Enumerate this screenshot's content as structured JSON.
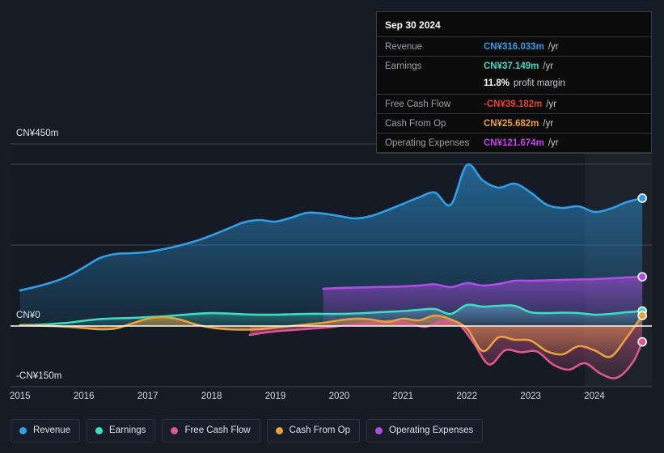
{
  "tooltip": {
    "title": "Sep 30 2024",
    "rows": [
      {
        "key": "Revenue",
        "value": "CN¥316.033m",
        "suffix": "/yr",
        "color": "#2f9fe8"
      },
      {
        "key": "Earnings",
        "value": "CN¥37.149m",
        "suffix": "/yr",
        "color": "#3ddcc4"
      },
      {
        "key": "",
        "value": "11.8%",
        "suffix": "profit margin",
        "color": "#ffffff",
        "sub": true
      },
      {
        "key": "Free Cash Flow",
        "value": "-CN¥39.182m",
        "suffix": "/yr",
        "color": "#e8442f"
      },
      {
        "key": "Cash From Op",
        "value": "CN¥25.682m",
        "suffix": "/yr",
        "color": "#e9a13b"
      },
      {
        "key": "Operating Expenses",
        "value": "CN¥121.674m",
        "suffix": "/yr",
        "color": "#cc3ef0"
      }
    ]
  },
  "axes": {
    "y_top_label": "CN¥450m",
    "y_zero_label": "CN¥0",
    "y_bottom_label": "-CN¥150m",
    "x_labels": [
      "2015",
      "2016",
      "2017",
      "2018",
      "2019",
      "2020",
      "2021",
      "2022",
      "2023",
      "2024"
    ]
  },
  "legend": {
    "items": [
      {
        "label": "Revenue",
        "color": "#2f9fe8"
      },
      {
        "label": "Earnings",
        "color": "#3ddcc4"
      },
      {
        "label": "Free Cash Flow",
        "color": "#e0578f"
      },
      {
        "label": "Cash From Op",
        "color": "#e9a13b"
      },
      {
        "label": "Operating Expenses",
        "color": "#b24ce8"
      }
    ]
  },
  "chart_data": {
    "type": "area",
    "title": "",
    "xlabel": "",
    "ylabel": "CN¥ (millions)",
    "ylim": [
      -150,
      450
    ],
    "xlim": [
      2014.85,
      2024.9
    ],
    "grid": true,
    "legend_position": "bottom",
    "currency": "CN¥",
    "unit": "m",
    "y_ticks": [
      450,
      400,
      200,
      0,
      -150
    ],
    "forecast_start": 2023.85,
    "series": [
      {
        "name": "Revenue",
        "color": "#2f9fe8",
        "x": [
          2015.0,
          2015.25,
          2015.5,
          2015.75,
          2016.0,
          2016.25,
          2016.5,
          2016.75,
          2017.0,
          2017.25,
          2017.5,
          2017.75,
          2018.0,
          2018.25,
          2018.5,
          2018.75,
          2019.0,
          2019.25,
          2019.5,
          2019.75,
          2020.0,
          2020.25,
          2020.5,
          2020.75,
          2021.0,
          2021.25,
          2021.5,
          2021.75,
          2022.0,
          2022.25,
          2022.5,
          2022.75,
          2023.0,
          2023.25,
          2023.5,
          2023.75,
          2024.0,
          2024.25,
          2024.5,
          2024.75
        ],
        "values": [
          88,
          97,
          108,
          123,
          145,
          168,
          178,
          180,
          183,
          190,
          199,
          210,
          224,
          240,
          256,
          262,
          258,
          268,
          280,
          278,
          272,
          266,
          272,
          286,
          302,
          318,
          330,
          300,
          398,
          360,
          342,
          352,
          330,
          300,
          292,
          296,
          282,
          290,
          306,
          316
        ]
      },
      {
        "name": "Earnings",
        "color": "#3ddcc4",
        "x": [
          2015.0,
          2015.25,
          2015.5,
          2015.75,
          2016.0,
          2016.25,
          2016.5,
          2016.75,
          2017.0,
          2017.25,
          2017.5,
          2017.75,
          2018.0,
          2018.25,
          2018.5,
          2018.75,
          2019.0,
          2019.25,
          2019.5,
          2019.75,
          2020.0,
          2020.25,
          2020.5,
          2020.75,
          2021.0,
          2021.25,
          2021.5,
          2021.75,
          2022.0,
          2022.25,
          2022.5,
          2022.75,
          2023.0,
          2023.25,
          2023.5,
          2023.75,
          2024.0,
          2024.25,
          2024.5,
          2024.75
        ],
        "values": [
          2,
          3,
          5,
          8,
          13,
          17,
          19,
          20,
          22,
          24,
          27,
          30,
          32,
          31,
          29,
          28,
          28,
          29,
          30,
          30,
          30,
          31,
          33,
          35,
          37,
          40,
          42,
          30,
          52,
          48,
          50,
          50,
          34,
          32,
          33,
          32,
          28,
          30,
          34,
          37
        ]
      },
      {
        "name": "Free Cash Flow",
        "color": "#e0578f",
        "x": [
          2018.6,
          2018.85,
          2019.1,
          2019.35,
          2019.6,
          2019.85,
          2020.1,
          2020.35,
          2020.6,
          2020.85,
          2021.1,
          2021.35,
          2021.6,
          2021.85,
          2022.1,
          2022.35,
          2022.6,
          2022.85,
          2023.1,
          2023.35,
          2023.6,
          2023.85,
          2024.1,
          2024.35,
          2024.6,
          2024.75
        ],
        "values": [
          -22,
          -16,
          -12,
          -9,
          -6,
          -3,
          2,
          6,
          10,
          12,
          7,
          -2,
          12,
          8,
          -40,
          -95,
          -60,
          -65,
          -63,
          -95,
          -108,
          -92,
          -118,
          -128,
          -90,
          -39
        ]
      },
      {
        "name": "Cash From Op",
        "color": "#e9a13b",
        "x": [
          2015.0,
          2015.25,
          2015.5,
          2015.75,
          2016.0,
          2016.25,
          2016.5,
          2016.75,
          2017.0,
          2017.25,
          2017.5,
          2017.75,
          2018.0,
          2018.25,
          2018.5,
          2018.75,
          2019.0,
          2019.25,
          2019.5,
          2019.75,
          2020.0,
          2020.25,
          2020.5,
          2020.75,
          2021.0,
          2021.25,
          2021.5,
          2021.75,
          2022.0,
          2022.25,
          2022.5,
          2022.75,
          2023.0,
          2023.25,
          2023.5,
          2023.75,
          2024.0,
          2024.25,
          2024.5,
          2024.75
        ],
        "values": [
          2,
          1,
          0,
          -2,
          -5,
          -8,
          -6,
          6,
          18,
          22,
          16,
          4,
          -4,
          -8,
          -9,
          -8,
          -4,
          0,
          4,
          8,
          14,
          18,
          16,
          10,
          18,
          14,
          26,
          16,
          -6,
          -62,
          -28,
          -34,
          -36,
          -62,
          -70,
          -50,
          -60,
          -76,
          -30,
          26
        ]
      },
      {
        "name": "Operating Expenses",
        "color": "#b24ce8",
        "x": [
          2019.75,
          2020.0,
          2020.25,
          2020.5,
          2020.75,
          2021.0,
          2021.25,
          2021.5,
          2021.75,
          2022.0,
          2022.25,
          2022.5,
          2022.75,
          2023.0,
          2023.25,
          2023.5,
          2023.75,
          2024.0,
          2024.25,
          2024.5,
          2024.75
        ],
        "values": [
          92,
          94,
          95,
          96,
          97,
          98,
          100,
          103,
          96,
          106,
          100,
          104,
          112,
          112,
          113,
          114,
          115,
          116,
          118,
          120,
          122
        ]
      }
    ],
    "endpoints": [
      {
        "name": "Revenue",
        "x": 2024.75,
        "value": 316.033,
        "color": "#2f9fe8"
      },
      {
        "name": "Operating Expenses",
        "x": 2024.75,
        "value": 121.674,
        "color": "#b24ce8"
      },
      {
        "name": "Earnings",
        "x": 2024.75,
        "value": 37.149,
        "color": "#3ddcc4"
      },
      {
        "name": "Cash From Op",
        "x": 2024.75,
        "value": 25.682,
        "color": "#e9a13b"
      },
      {
        "name": "Free Cash Flow",
        "x": 2024.75,
        "value": -39.182,
        "color": "#e0578f"
      }
    ]
  }
}
